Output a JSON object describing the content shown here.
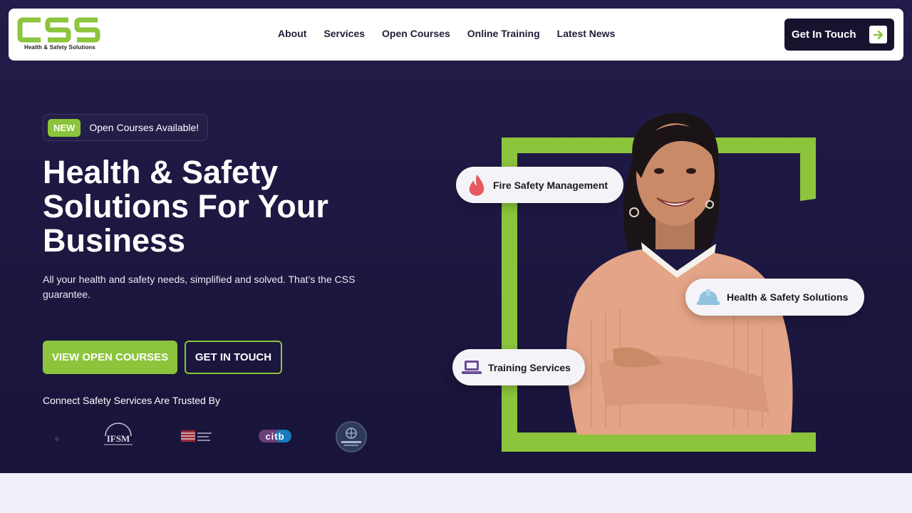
{
  "header": {
    "logo": {
      "mark_text": "CSS",
      "tagline": "Health & Safety Solutions"
    },
    "nav": [
      "About",
      "Services",
      "Open Courses",
      "Online Training",
      "Latest News"
    ],
    "cta_label": "Get In Touch"
  },
  "hero": {
    "badge_tag": "NEW",
    "badge_text": "Open Courses Available!",
    "headline": "Health & Safety Solutions For Your Business",
    "subtext": "All your health and safety needs, simplified and solved. That’s the CSS guarantee.",
    "primary_button": "VIEW OPEN COURSES",
    "secondary_button": "GET IN TOUCH",
    "trusted_label": "Connect Safety Services Are Trusted By",
    "trusted_logos": [
      "IFSM",
      "citb"
    ]
  },
  "illustration": {
    "pills": [
      {
        "label": "Fire Safety Management",
        "icon": "flame-icon"
      },
      {
        "label": "Health & Safety Solutions",
        "icon": "hard-hat-icon"
      },
      {
        "label": "Training Services",
        "icon": "laptop-icon"
      }
    ]
  },
  "colors": {
    "accent": "#8cc43c",
    "hero_bg": "#1d183f",
    "dark_button": "#16132e"
  }
}
